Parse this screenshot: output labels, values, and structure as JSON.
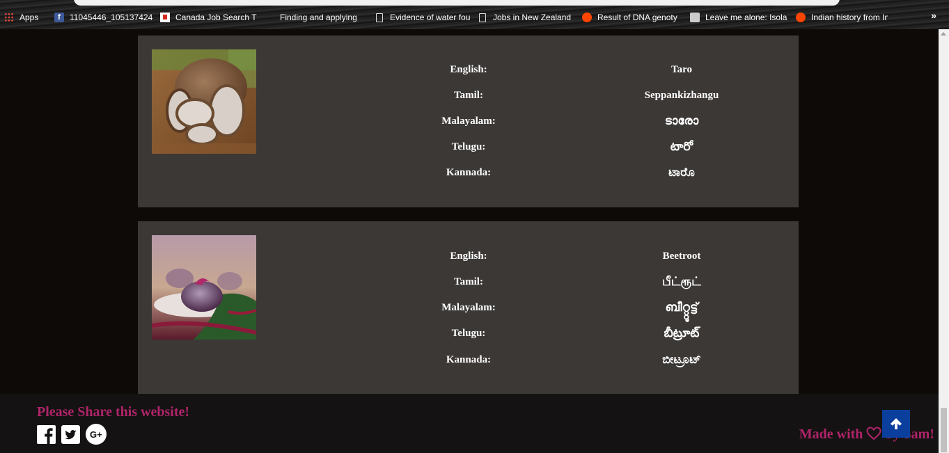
{
  "bookmarks": {
    "items": [
      {
        "label": "Apps",
        "icon": "apps-grid-icon"
      },
      {
        "label": "11045446_105137424",
        "icon": "facebook-icon"
      },
      {
        "label": "Canada Job Search T",
        "icon": "canada-flag-icon"
      },
      {
        "label": "Finding and applying",
        "icon": "blank-icon"
      },
      {
        "label": "Evidence of water fou",
        "icon": "document-icon"
      },
      {
        "label": "Jobs in New Zealand",
        "icon": "document-icon"
      },
      {
        "label": "Result of DNA genoty",
        "icon": "reddit-icon"
      },
      {
        "label": "Leave me alone: Isola",
        "icon": "site-icon"
      },
      {
        "label": "Indian history from In",
        "icon": "reddit-icon"
      }
    ],
    "overflow": "»"
  },
  "vegetables": [
    {
      "image_name": "taro-image",
      "rows": [
        {
          "label": "English:",
          "value": "Taro"
        },
        {
          "label": "Tamil:",
          "value": "Seppankizhangu"
        },
        {
          "label": "Malayalam:",
          "value": "ടാരോ"
        },
        {
          "label": "Telugu:",
          "value": "టారో"
        },
        {
          "label": "Kannada:",
          "value": "ಟಾರೊ"
        }
      ]
    },
    {
      "image_name": "beetroot-image",
      "rows": [
        {
          "label": "English:",
          "value": "Beetroot"
        },
        {
          "label": "Tamil:",
          "value": "பீட்ரூட்"
        },
        {
          "label": "Malayalam:",
          "value": "ബീറ്റ്റൂട്ട്"
        },
        {
          "label": "Telugu:",
          "value": "బీట్రూట్"
        },
        {
          "label": "Kannada:",
          "value": "ಬೀಟ್ರೂಟ್"
        }
      ]
    }
  ],
  "footer": {
    "share_title": "Please Share this website!",
    "made_prefix": "Made with",
    "made_suffix": "by Sam!",
    "social": [
      "facebook-icon",
      "twitter-icon",
      "google-plus-icon"
    ]
  },
  "colors": {
    "accent_pink": "#b0246a",
    "card_bg": "#3b3836",
    "page_bg": "#0e0a08",
    "back_to_top": "#0b3f9e"
  }
}
